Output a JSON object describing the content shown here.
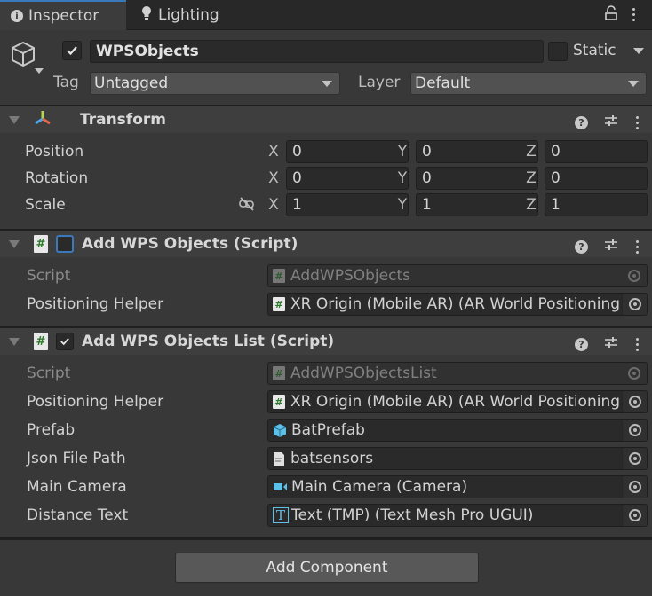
{
  "tabs": [
    {
      "label": "Inspector",
      "icon": "info-icon",
      "active": true
    },
    {
      "label": "Lighting",
      "icon": "lightbulb-icon",
      "active": false
    }
  ],
  "header": {
    "object_name": "WPSObjects",
    "active": true,
    "static_label": "Static",
    "static_checked": false,
    "tag_label": "Tag",
    "tag_value": "Untagged",
    "layer_label": "Layer",
    "layer_value": "Default"
  },
  "transform": {
    "title": "Transform",
    "rows": [
      {
        "label": "Position",
        "x": "0",
        "y": "0",
        "z": "0"
      },
      {
        "label": "Rotation",
        "x": "0",
        "y": "0",
        "z": "0"
      },
      {
        "label": "Scale",
        "x": "1",
        "y": "1",
        "z": "1"
      }
    ],
    "axes": {
      "x": "X",
      "y": "Y",
      "z": "Z"
    }
  },
  "components": [
    {
      "title": "Add WPS Objects (Script)",
      "enabled": false,
      "fields": [
        {
          "label": "Script",
          "value": "AddWPSObjects",
          "icon": "script-icon",
          "disabled": true
        },
        {
          "label": "Positioning Helper",
          "value": "XR Origin (Mobile AR) (AR World Positioning",
          "icon": "script-icon"
        }
      ]
    },
    {
      "title": "Add WPS Objects List (Script)",
      "enabled": true,
      "fields": [
        {
          "label": "Script",
          "value": "AddWPSObjectsList",
          "icon": "script-icon",
          "disabled": true
        },
        {
          "label": "Positioning Helper",
          "value": "XR Origin (Mobile AR) (AR World Positioning",
          "icon": "script-icon"
        },
        {
          "label": "Prefab",
          "value": "BatPrefab",
          "icon": "prefab-icon"
        },
        {
          "label": "Json File Path",
          "value": "batsensors",
          "icon": "text-file-icon"
        },
        {
          "label": "Main Camera",
          "value": "Main Camera (Camera)",
          "icon": "camera-icon"
        },
        {
          "label": "Distance Text",
          "value": "Text (TMP) (Text Mesh Pro UGUI)",
          "icon": "tmp-text-icon"
        }
      ]
    }
  ],
  "add_component_label": "Add Component",
  "colors": {
    "accent": "#3a79bb",
    "prefab": "#5cc0e8",
    "camera": "#5cc0e8"
  }
}
